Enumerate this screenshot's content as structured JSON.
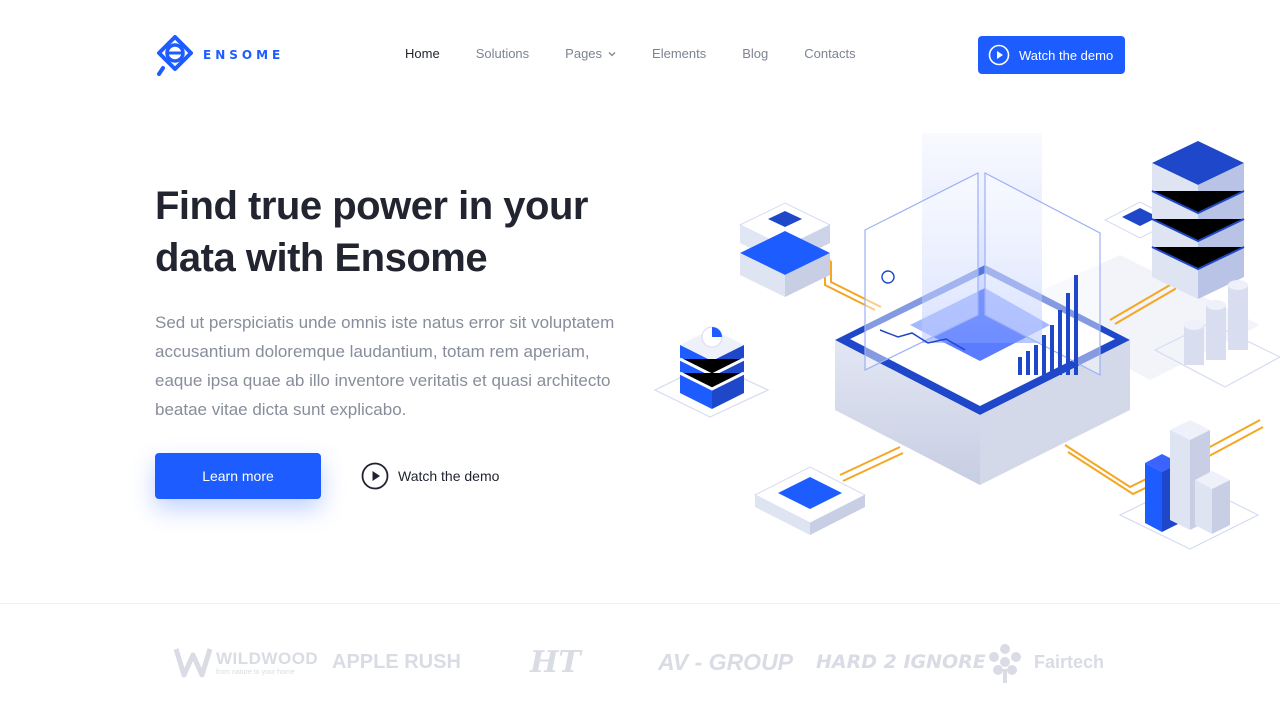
{
  "header": {
    "logo_text": "ENSOME",
    "nav": [
      {
        "label": "Home",
        "active": true
      },
      {
        "label": "Solutions"
      },
      {
        "label": "Pages",
        "has_dropdown": true
      },
      {
        "label": "Elements"
      },
      {
        "label": "Blog"
      },
      {
        "label": "Contacts"
      }
    ],
    "cta_label": "Watch the demo"
  },
  "hero": {
    "title_line1": "Find true power in your",
    "title_line2": "data with Ensome",
    "description": "Sed ut perspiciatis unde omnis iste natus error sit voluptatem accusantium doloremque laudantium, totam rem aperiam, eaque ipsa quae ab illo inventore veritatis et quasi architecto beatae vitae dicta sunt explicabo.",
    "primary_button": "Learn more",
    "secondary_button": "Watch the demo"
  },
  "brands": [
    {
      "name": "WILDWOOD",
      "tagline": "from nature to your home"
    },
    {
      "name": "APPLE RUSH"
    },
    {
      "name": "HT"
    },
    {
      "name": "AV - GROUP"
    },
    {
      "name": "HARD 2 IGNORE"
    },
    {
      "name": "Fairtech"
    }
  ],
  "colors": {
    "accent": "#1d5cff",
    "title": "#22252f",
    "muted_text": "#878d9b",
    "nav_text": "#7c8394",
    "brand_gray": "#d9dce4",
    "wire_orange": "#f5a623"
  },
  "icons": {
    "play": "play-circle-icon",
    "chevron": "chevron-down-icon",
    "logo": "ensome-logo-icon"
  }
}
